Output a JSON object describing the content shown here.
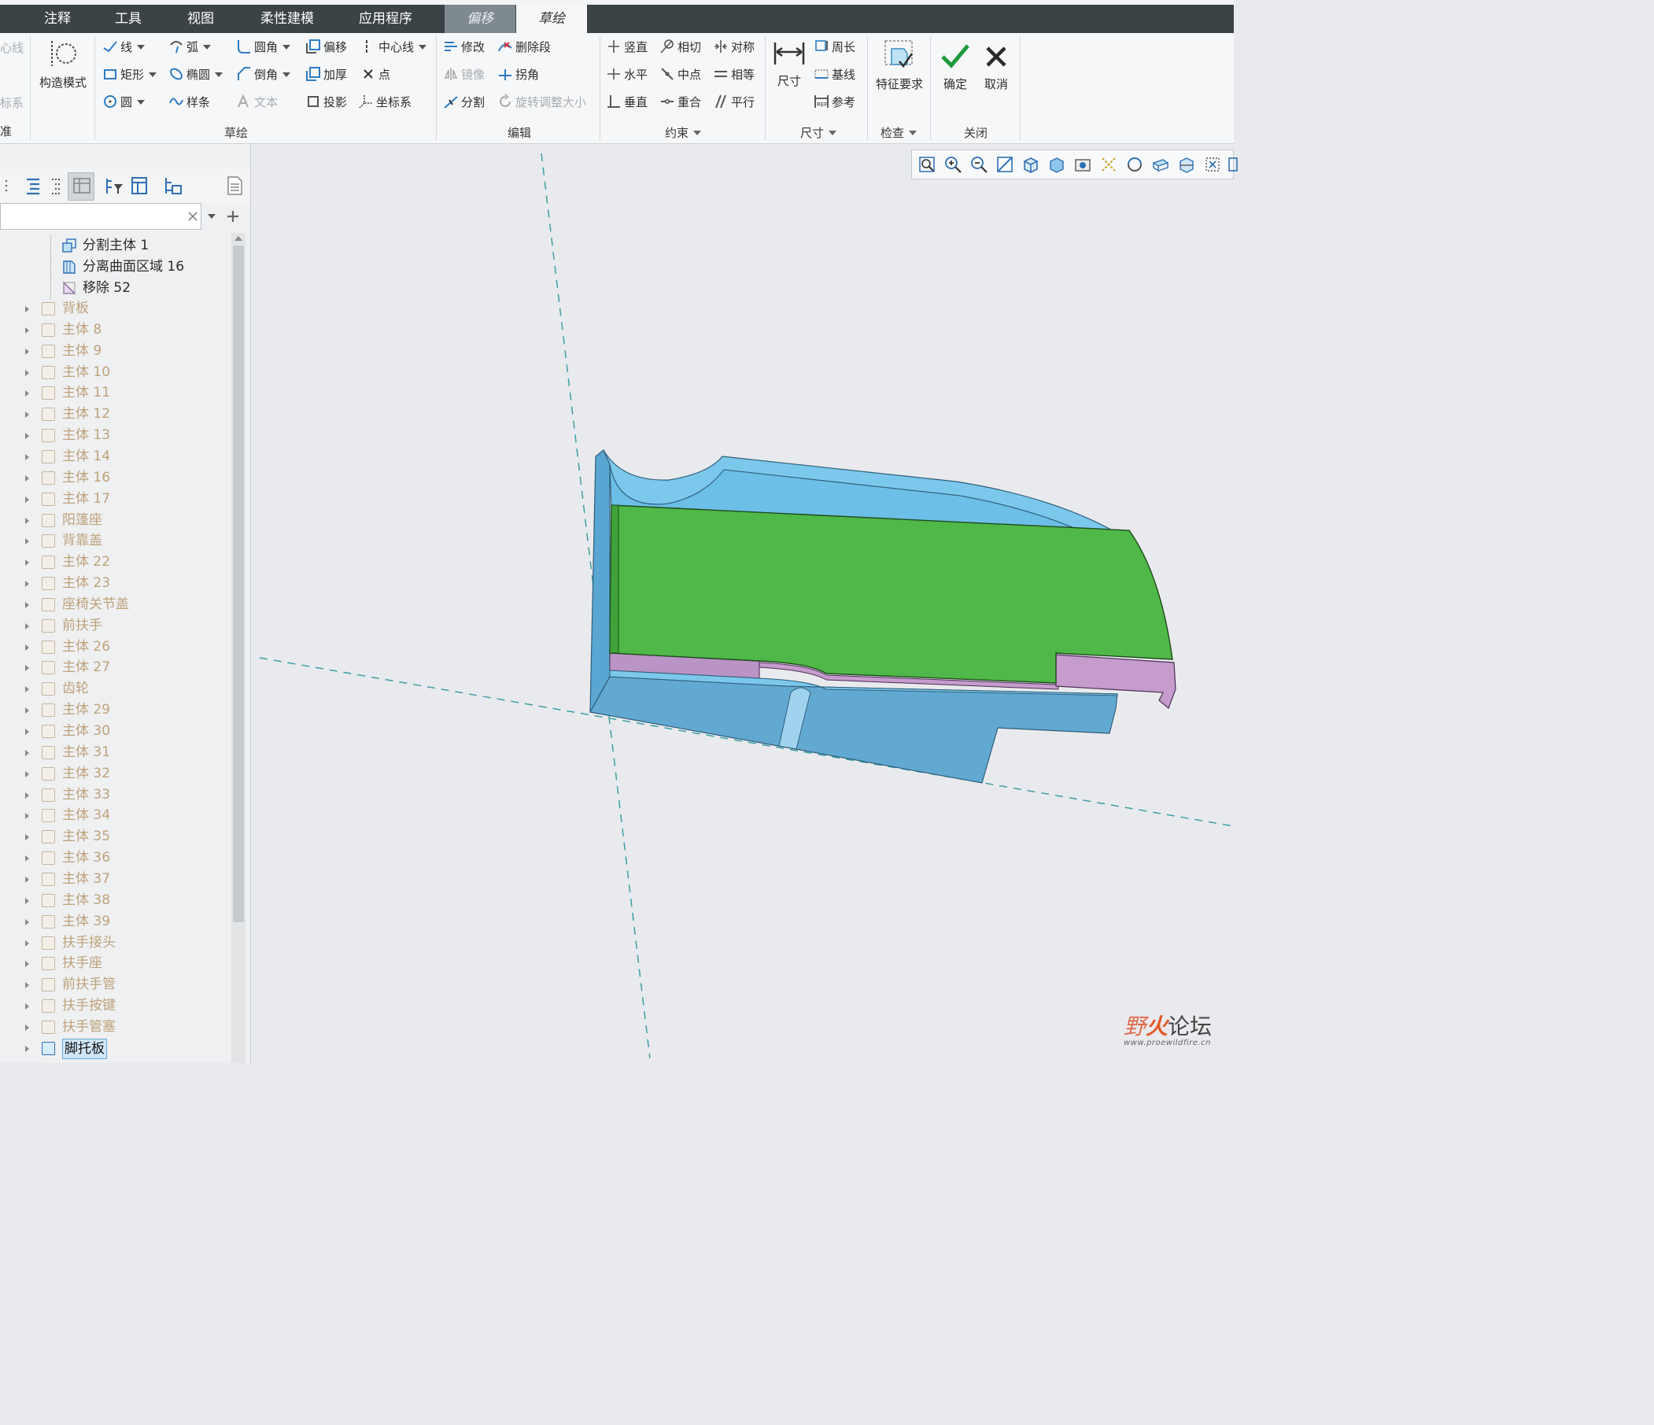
{
  "tabs": [
    {
      "label": "注释"
    },
    {
      "label": "工具"
    },
    {
      "label": "视图"
    },
    {
      "label": "柔性建模"
    },
    {
      "label": "应用程序"
    },
    {
      "label": "偏移"
    },
    {
      "label": "草绘"
    }
  ],
  "ribbon": {
    "cut_left": {
      "centerline": "心线",
      "coord": "标系",
      "edge": "准"
    },
    "construct_mode": "构造模式",
    "sketch": {
      "line": "线",
      "arc": "弧",
      "fillet": "圆角",
      "offset": "偏移",
      "centerline": "中心线",
      "rectangle": "矩形",
      "ellipse": "椭圆",
      "chamfer": "倒角",
      "thicken": "加厚",
      "point": "点",
      "circle": "圆",
      "spline": "样条",
      "text": "文本",
      "project": "投影",
      "coord_system": "坐标系",
      "group": "草绘"
    },
    "edit": {
      "modify": "修改",
      "delete_segment": "删除段",
      "mirror": "镜像",
      "corner": "拐角",
      "divide": "分割",
      "rotate_resize": "旋转调整大小",
      "group": "编辑"
    },
    "constrain": {
      "vertical": "竖直",
      "tangent": "相切",
      "symmetric": "对称",
      "horizontal": "水平",
      "midpoint": "中点",
      "equal": "相等",
      "perpendicular": "垂直",
      "coincident": "重合",
      "parallel": "平行",
      "group": "约束"
    },
    "dimension": {
      "dimension": "尺寸",
      "perimeter": "周长",
      "baseline": "基线",
      "reference": "参考",
      "group": "尺寸"
    },
    "inspect": {
      "feature_requirements": "特征要求",
      "group": "检查"
    },
    "close": {
      "ok": "确定",
      "cancel": "取消",
      "group": "关闭"
    }
  },
  "tree": {
    "search_value": "",
    "children": [
      "分割主体 1",
      "分离曲面区域 16",
      "移除 52"
    ],
    "items": [
      "背板",
      "主体 8",
      "主体 9",
      "主体 10",
      "主体 11",
      "主体 12",
      "主体 13",
      "主体 14",
      "主体 16",
      "主体 17",
      "阳篷座",
      "背靠盖",
      "主体 22",
      "主体 23",
      "座椅关节盖",
      "前扶手",
      "主体 26",
      "主体 27",
      "齿轮",
      "主体 29",
      "主体 30",
      "主体 31",
      "主体 32",
      "主体 33",
      "主体 34",
      "主体 35",
      "主体 36",
      "主体 37",
      "主体 38",
      "主体 39",
      "扶手接头",
      "扶手座",
      "前扶手管",
      "扶手按键",
      "扶手管塞",
      "脚托板"
    ],
    "selected": "脚托板"
  },
  "watermark": {
    "brand_a": "野",
    "brand_b": "火",
    "brand_c": "论坛",
    "url": "www.proewildfire.cn"
  },
  "colors": {
    "tabbar": "#3c4347",
    "ribbon": "#f6f7f8",
    "viewport": "#e9eaed",
    "model_green": "#4fb848",
    "model_blue": "#6fc2e6",
    "model_pink": "#c59ccc",
    "selection": "#cfe6f8"
  }
}
